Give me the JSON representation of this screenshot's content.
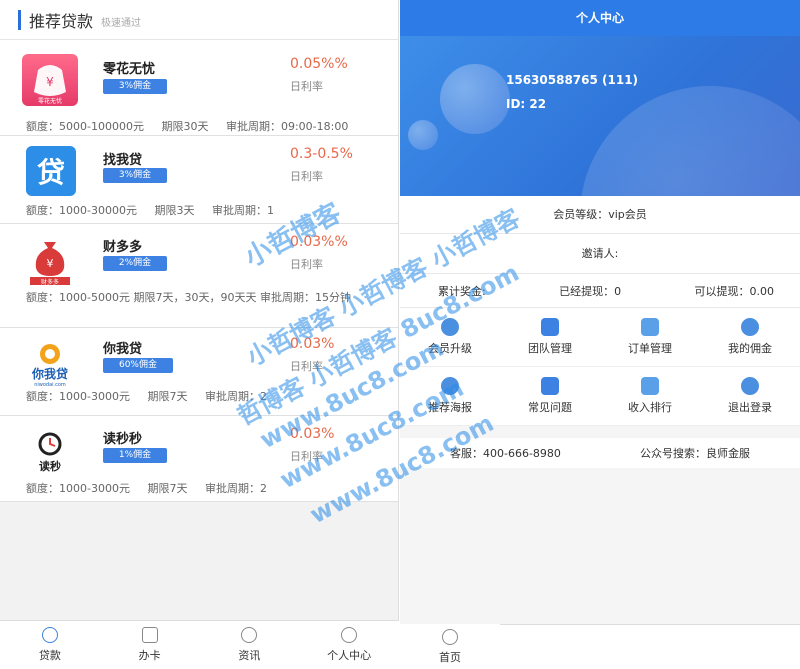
{
  "left": {
    "header_title": "推荐贷款",
    "header_sub": "极速通过",
    "loans": [
      {
        "name": "零花无忧",
        "tag": "3%佣金",
        "rate": "0.05%%",
        "rate_label": "日利率",
        "meta": [
          "额度：5000-100000元",
          "期限30天",
          "审批周期：09:00-18:00"
        ]
      },
      {
        "name": "找我贷",
        "tag": "3%佣金",
        "rate": "0.3-0.5%",
        "rate_label": "日利率",
        "meta": [
          "额度：1000-30000元",
          "期限3天",
          "审批周期：1"
        ]
      },
      {
        "name": "财多多",
        "tag": "2%佣金",
        "rate": "0.03%%",
        "rate_label": "日利率",
        "meta_text": "额度：1000-5000元    期限7天，30天，90天天    审批周期：15分钟"
      },
      {
        "name": "你我贷",
        "tag": "60%佣金",
        "rate": "0.03%",
        "rate_label": "日利率",
        "meta": [
          "额度：1000-3000元",
          "期限7天",
          "审批周期：2"
        ]
      },
      {
        "name": "读秒秒",
        "tag": "1%佣金",
        "rate": "0.03%",
        "rate_label": "日利率",
        "meta": [
          "额度：1000-3000元",
          "期限7天",
          "审批周期：2"
        ]
      }
    ],
    "tabs": [
      "贷款",
      "办卡",
      "资讯",
      "个人中心"
    ]
  },
  "right": {
    "title": "个人中心",
    "phone": "15630588765 (111)",
    "uid": "ID: 22",
    "level": "会员等级：vip会员",
    "inviter": "邀请人:",
    "money": {
      "total": "累计奖金:",
      "withdrawn": "已经提现：0",
      "available": "可以提现：0.00"
    },
    "grid": [
      "会员升级",
      "团队管理",
      "订单管理",
      "我的佣金",
      "推荐海报",
      "常见问题",
      "收入排行",
      "退出登录"
    ],
    "service": "客服：400-666-8980",
    "wechat": "公众号搜索：良师金服",
    "home_tab": "首页"
  },
  "watermark": [
    "小哲博客",
    "小哲博客 小哲博客 小哲博客",
    "哲博客 小哲博客 8uc8.com",
    "www.8uc8.com",
    "www.8uc8.com",
    "www.8uc8.com"
  ],
  "colors": {
    "primary": "#2d7be6",
    "rate": "#e8684a",
    "tag": "#3d82e3"
  }
}
